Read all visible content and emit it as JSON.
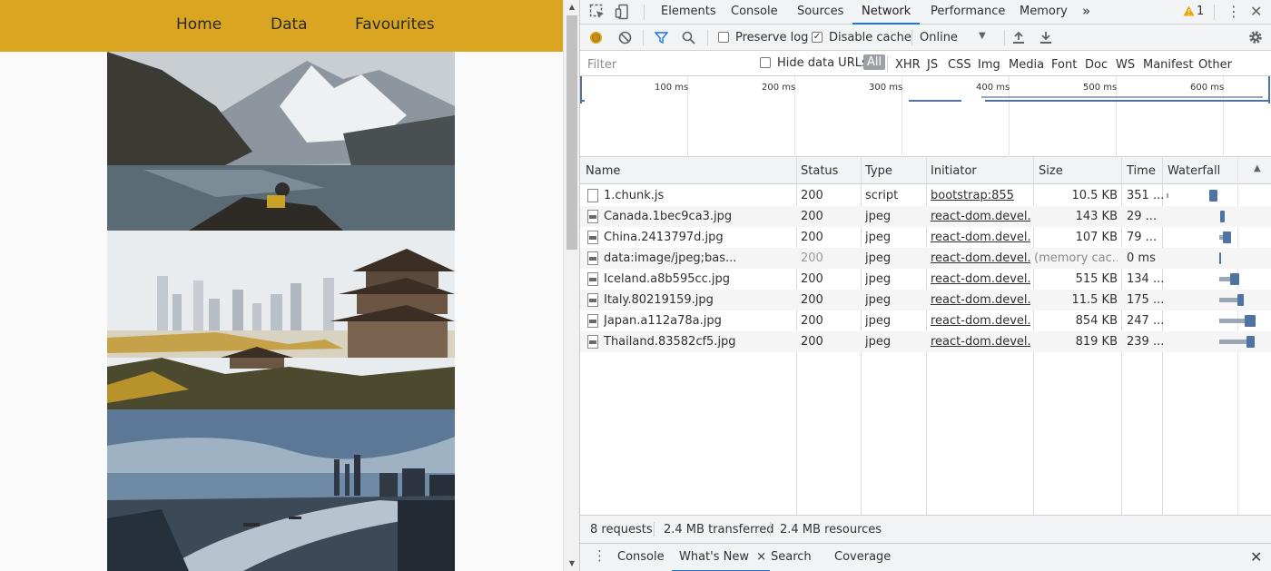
{
  "site": {
    "nav": [
      "Home",
      "Data",
      "Favourites"
    ],
    "nav_color": "#daa520"
  },
  "devtools": {
    "tabs": [
      "Elements",
      "Console",
      "Sources",
      "Network",
      "Performance",
      "Memory"
    ],
    "active_tab": "Network",
    "more_tabs": "»",
    "warnings": "1",
    "toolbar": {
      "preserve_log": "Preserve log",
      "preserve_log_checked": false,
      "disable_cache": "Disable cache",
      "disable_cache_checked": true,
      "throttling": "Online"
    },
    "filter": {
      "placeholder": "Filter",
      "hide_data_urls": "Hide data URLs",
      "types": [
        "All",
        "XHR",
        "JS",
        "CSS",
        "Img",
        "Media",
        "Font",
        "Doc",
        "WS",
        "Manifest",
        "Other"
      ],
      "active_type": "All"
    },
    "overview_ticks": [
      "100 ms",
      "200 ms",
      "300 ms",
      "400 ms",
      "500 ms",
      "600 ms"
    ],
    "columns": [
      "Name",
      "Status",
      "Type",
      "Initiator",
      "Size",
      "Time",
      "Waterfall"
    ],
    "requests": [
      {
        "name": "1.chunk.js",
        "status": "200",
        "type": "script",
        "initiator": "bootstrap:855",
        "size": "10.5 KB",
        "time": "351 ...",
        "icon": "script-file-icon"
      },
      {
        "name": "Canada.1bec9ca3.jpg",
        "status": "200",
        "type": "jpeg",
        "initiator": "react-dom.devel...",
        "size": "143 KB",
        "time": "29 ...",
        "icon": "image-file-icon"
      },
      {
        "name": "China.2413797d.jpg",
        "status": "200",
        "type": "jpeg",
        "initiator": "react-dom.devel...",
        "size": "107 KB",
        "time": "79 ...",
        "icon": "image-file-icon"
      },
      {
        "name": "data:image/jpeg;bas...",
        "status": "200",
        "type": "jpeg",
        "initiator": "react-dom.devel...",
        "size": "(memory cac...",
        "time": "0 ms",
        "icon": "image-file-icon"
      },
      {
        "name": "Iceland.a8b595cc.jpg",
        "status": "200",
        "type": "jpeg",
        "initiator": "react-dom.devel...",
        "size": "515 KB",
        "time": "134 ...",
        "icon": "image-file-icon"
      },
      {
        "name": "Italy.80219159.jpg",
        "status": "200",
        "type": "jpeg",
        "initiator": "react-dom.devel...",
        "size": "11.5 KB",
        "time": "175 ...",
        "icon": "image-file-icon"
      },
      {
        "name": "Japan.a112a78a.jpg",
        "status": "200",
        "type": "jpeg",
        "initiator": "react-dom.devel...",
        "size": "854 KB",
        "time": "247 ...",
        "icon": "image-file-icon"
      },
      {
        "name": "Thailand.83582cf5.jpg",
        "status": "200",
        "type": "jpeg",
        "initiator": "react-dom.devel...",
        "size": "819 KB",
        "time": "239 ...",
        "icon": "image-file-icon"
      }
    ],
    "summary": {
      "requests": "8 requests",
      "transferred": "2.4 MB transferred",
      "resources": "2.4 MB resources"
    },
    "drawer": {
      "tabs": [
        "Console",
        "What's New",
        "Search",
        "Coverage"
      ],
      "active": "What's New",
      "tab_close": "×",
      "drawer_close": "✕"
    }
  }
}
